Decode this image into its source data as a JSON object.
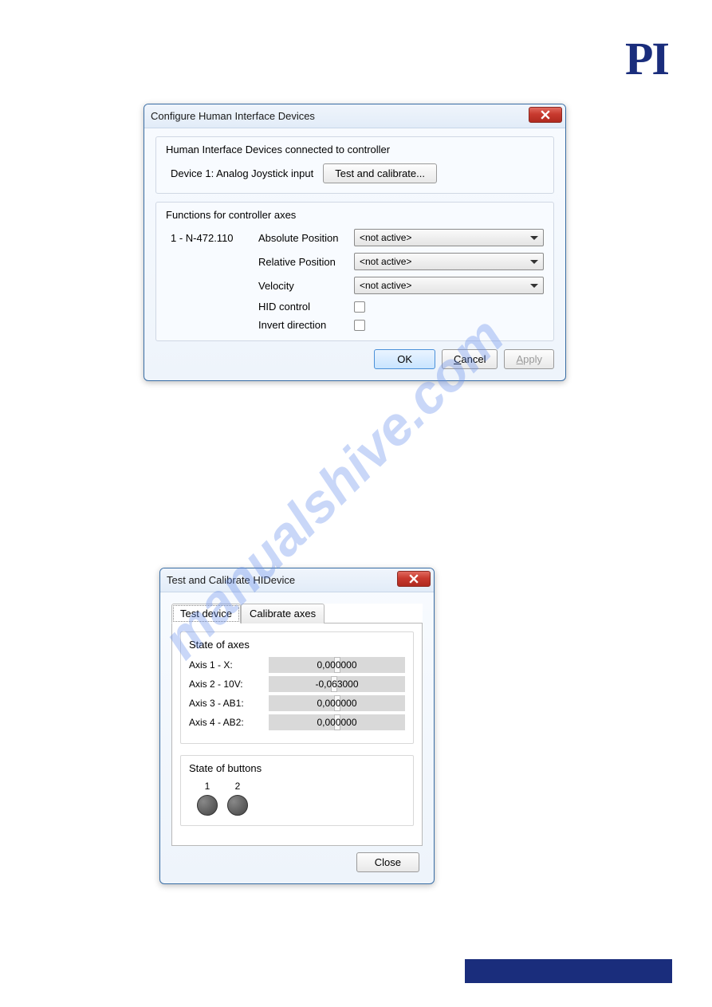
{
  "logo": "PI",
  "watermark": "manualshive.com",
  "dialog1": {
    "title": "Configure Human Interface Devices",
    "group1": {
      "legend": "Human Interface Devices connected to controller",
      "device_label": "Device 1: Analog Joystick input",
      "test_btn": "Test and calibrate..."
    },
    "group2": {
      "legend": "Functions for controller axes",
      "axis_id": "1 - N-472.110",
      "rows": {
        "abs_label": "Absolute Position",
        "abs_value": "<not active>",
        "rel_label": "Relative Position",
        "rel_value": "<not active>",
        "vel_label": "Velocity",
        "vel_value": "<not active>",
        "hid_label": "HID control",
        "inv_label": "Invert direction"
      }
    },
    "buttons": {
      "ok": "OK",
      "cancel": "Cancel",
      "apply": "Apply"
    }
  },
  "dialog2": {
    "title": "Test and Calibrate HIDevice",
    "tabs": {
      "test": "Test device",
      "cal": "Calibrate axes"
    },
    "state_axes": {
      "legend": "State of axes",
      "axes": [
        {
          "label": "Axis 1 - X:",
          "value": "0,000000"
        },
        {
          "label": "Axis 2 - 10V:",
          "value": "-0,063000"
        },
        {
          "label": "Axis 3 - AB1:",
          "value": "0,000000"
        },
        {
          "label": "Axis 4 - AB2:",
          "value": "0,000000"
        }
      ]
    },
    "state_buttons": {
      "legend": "State of buttons",
      "labels": [
        "1",
        "2"
      ]
    },
    "close": "Close"
  }
}
